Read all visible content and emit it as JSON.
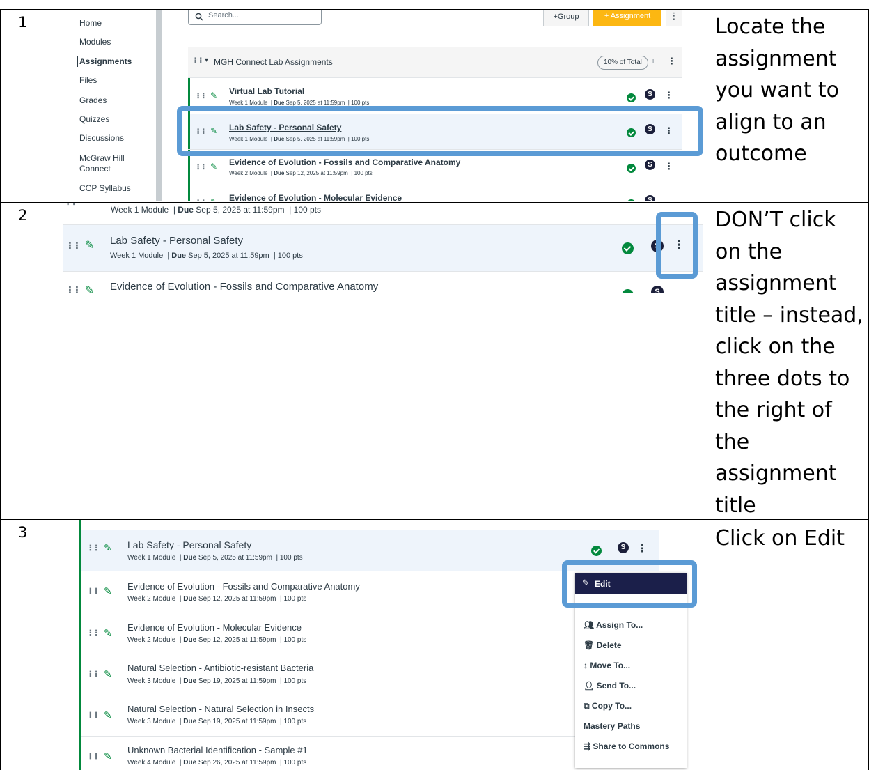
{
  "steps": [
    {
      "number": "1",
      "instruction": "Locate the assignment you want to align to an outcome"
    },
    {
      "number": "2",
      "instruction": "DON’T click on the assignment title – instead, click on the three dots to the right of the assignment title"
    },
    {
      "number": "3",
      "instruction": "Click on Edit"
    }
  ],
  "nav": [
    "Home",
    "Modules",
    "Assignments",
    "Files",
    "Grades",
    "Quizzes",
    "Discussions",
    "McGraw Hill Connect",
    "CCP Syllabus"
  ],
  "search": {
    "placeholder": "Search..."
  },
  "toolbar": {
    "group_label": "+Group",
    "assignment_label": "+ Assignment",
    "more_label": "⋮"
  },
  "group": {
    "name": "MGH Connect Lab Assignments",
    "weight": "10% of Total"
  },
  "assignments": [
    {
      "title": "Virtual Lab Tutorial",
      "module": "Week 1 Module",
      "due_label": "Due",
      "due": "Sep 5, 2025 at 11:59pm",
      "pts": "100 pts"
    },
    {
      "title": "Lab Safety - Personal Safety",
      "module": "Week 1 Module",
      "due_label": "Due",
      "due": "Sep 5, 2025 at 11:59pm",
      "pts": "100 pts"
    },
    {
      "title": "Evidence of Evolution - Fossils and Comparative Anatomy",
      "module": "Week 2 Module",
      "due_label": "Due",
      "due": "Sep 12, 2025 at 11:59pm",
      "pts": "100 pts"
    },
    {
      "title": "Evidence of Evolution - Molecular Evidence",
      "module": "Week 2 Module",
      "due_label": "Due",
      "due": "Sep 12, 2025 at 11:59pm",
      "pts": "100 pts"
    },
    {
      "title": "Natural Selection - Antibiotic-resistant Bacteria",
      "module": "Week 3 Module",
      "due_label": "Due",
      "due": "Sep 19, 2025 at 11:59pm",
      "pts": "100 pts"
    },
    {
      "title": "Natural Selection - Natural Selection in Insects",
      "module": "Week 3 Module",
      "due_label": "Due",
      "due": "Sep 19, 2025 at 11:59pm",
      "pts": "100 pts"
    },
    {
      "title": "Unknown Bacterial Identification - Sample #1",
      "module": "Week 4 Module",
      "due_label": "Due",
      "due": "Sep 26, 2025 at 11:59pm",
      "pts": "100 pts"
    }
  ],
  "menu": {
    "edit": "Edit",
    "items": [
      "Assign To...",
      "Delete",
      "Move To...",
      "Send To...",
      "Copy To...",
      "Mastery Paths",
      "Share to Commons"
    ]
  },
  "icons": {
    "sync": "S",
    "kebab": "⋮",
    "drag": "⠇⠇",
    "caret": "▾"
  },
  "colors": {
    "published": "#03893d",
    "highlight": "#5b9bd5",
    "toolbar_accent": "#fcb712",
    "menu_selected": "#1b1f4a"
  }
}
